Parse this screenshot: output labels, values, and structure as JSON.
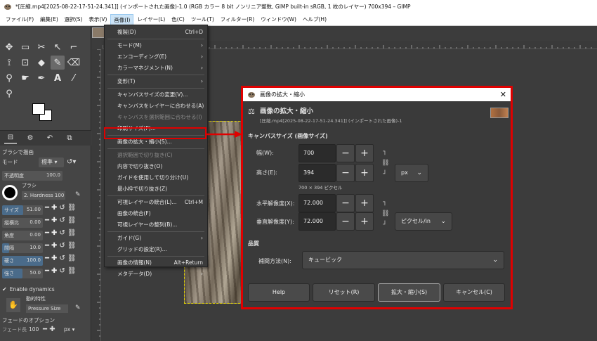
{
  "window": {
    "title": "*[圧縮.mp4[2025-08-22-17-51-24.341]] (インポートされた画像)-1.0 (RGB カラー 8 bit ノンリニア整数, GIMP built-in sRGB, 1 枚のレイヤー) 700x394 – GIMP"
  },
  "menubar": [
    "ファイル(F)",
    "編集(E)",
    "選択(S)",
    "表示(V)",
    "画像(I)",
    "レイヤー(L)",
    "色(C)",
    "ツール(T)",
    "フィルター(R)",
    "ウィンドウ(W)",
    "ヘルプ(H)"
  ],
  "menubar_active_index": 4,
  "image_menu": {
    "items": [
      {
        "label": "複製(D)",
        "shortcut": "Ctrl+D",
        "disabled": false,
        "submenu": false
      },
      {
        "label": "モード(M)",
        "shortcut": "",
        "disabled": false,
        "submenu": true
      },
      {
        "label": "エンコーディング(E)",
        "shortcut": "",
        "disabled": false,
        "submenu": true
      },
      {
        "label": "カラーマネジメント(N)",
        "shortcut": "",
        "disabled": false,
        "submenu": true
      },
      {
        "label": "変形(T)",
        "shortcut": "",
        "disabled": false,
        "submenu": true
      },
      {
        "label": "キャンバスサイズの変更(V)...",
        "shortcut": "",
        "disabled": false,
        "submenu": false
      },
      {
        "label": "キャンバスをレイヤーに合わせる(A)",
        "shortcut": "",
        "disabled": false,
        "submenu": false
      },
      {
        "label": "キャンバスを選択範囲に合わせる(I)",
        "shortcut": "",
        "disabled": true,
        "submenu": false
      },
      {
        "label": "印刷サイズ(P)...",
        "shortcut": "",
        "disabled": false,
        "submenu": false
      },
      {
        "label": "画像の拡大・縮小(S)...",
        "shortcut": "",
        "disabled": false,
        "submenu": false
      },
      {
        "label": "選択範囲で切り抜き(C)",
        "shortcut": "",
        "disabled": true,
        "submenu": false
      },
      {
        "label": "内容で切り抜き(O)",
        "shortcut": "",
        "disabled": false,
        "submenu": false
      },
      {
        "label": "ガイドを使用して切り分け(U)",
        "shortcut": "",
        "disabled": false,
        "submenu": false
      },
      {
        "label": "最小枠で切り抜き(Z)",
        "shortcut": "",
        "disabled": false,
        "submenu": false
      },
      {
        "label": "可視レイヤーの統合(L)...",
        "shortcut": "Ctrl+M",
        "disabled": false,
        "submenu": false
      },
      {
        "label": "画像の統合(F)",
        "shortcut": "",
        "disabled": false,
        "submenu": false
      },
      {
        "label": "可視レイヤーの整列(B)...",
        "shortcut": "",
        "disabled": false,
        "submenu": false
      },
      {
        "label": "ガイド(G)",
        "shortcut": "",
        "disabled": false,
        "submenu": true
      },
      {
        "label": "グリッドの設定(R)...",
        "shortcut": "",
        "disabled": false,
        "submenu": false
      },
      {
        "label": "画像の情報(N)",
        "shortcut": "Alt+Return",
        "disabled": false,
        "submenu": false
      },
      {
        "label": "メタデータ(D)",
        "shortcut": "",
        "disabled": false,
        "submenu": true
      }
    ]
  },
  "tool_options": {
    "title": "ブラシで描画",
    "mode_label": "モード",
    "mode_value": "標準",
    "opacity_label": "不透明度",
    "opacity_value": "100.0",
    "brush_label": "ブラシ",
    "brush_name": "2. Hardness 100",
    "sliders": [
      {
        "label": "サイズ",
        "value": "51.00"
      },
      {
        "label": "縦横比",
        "value": "0.00"
      },
      {
        "label": "角度",
        "value": "0.00"
      },
      {
        "label": "間隔",
        "value": "10.0"
      },
      {
        "label": "硬さ",
        "value": "100.0"
      },
      {
        "label": "強さ",
        "value": "50.0"
      }
    ],
    "enable_dynamics": "Enable dynamics",
    "dynamics_label": "動的特性",
    "dynamics_value": "Pressure Size",
    "fade_label": "フェードのオプション",
    "fade_length_label": "フェード長",
    "fade_length_value": "100",
    "fade_unit": "px"
  },
  "dialog": {
    "title": "画像の拡大・縮小",
    "heading": "画像の拡大・縮小",
    "subheading": "[圧縮.mp4[2025-08-22-17-51-24.341]] (インポートされた画像)-1",
    "canvas_section": "キャンバスサイズ (画像サイズ)",
    "width_label": "幅(W):",
    "width_value": "700",
    "height_label": "高さ(E):",
    "height_value": "394",
    "size_unit": "px",
    "size_info": "700 × 394 ピクセル",
    "xres_label": "水平解像度(X):",
    "xres_value": "72.000",
    "yres_label": "垂直解像度(Y):",
    "yres_value": "72.000",
    "res_unit": "ピクセル/in",
    "quality_section": "品質",
    "interp_label": "補間方法(N):",
    "interp_value": "キュービック",
    "buttons": {
      "help": "Help",
      "reset": "リセット(R)",
      "scale": "拡大・縮小(S)",
      "cancel": "キャンセル(C)"
    }
  },
  "ruler_labels": [
    "250",
    "500",
    "750",
    "1000",
    "1250",
    "1500"
  ],
  "colors": {
    "highlight": "#e00000",
    "dark_bg": "#3c3c3c"
  }
}
